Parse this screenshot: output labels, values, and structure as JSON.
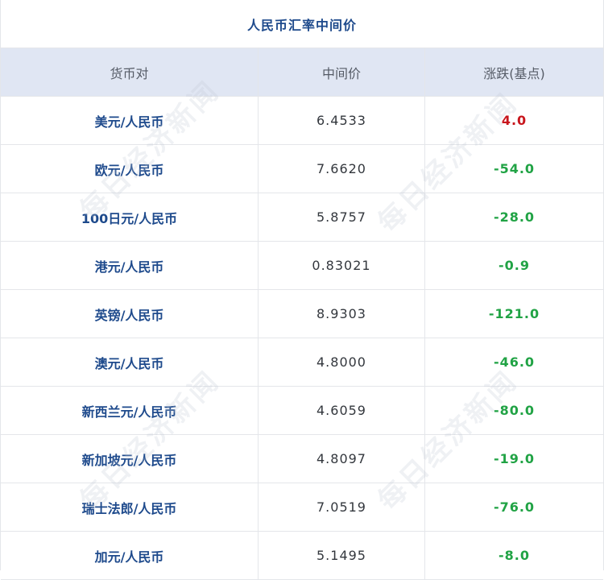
{
  "title": "人民币汇率中间价",
  "headers": [
    "货币对",
    "中间价",
    "涨跌(基点)"
  ],
  "rows": [
    {
      "pair": "美元/人民币",
      "mid": "6.4533",
      "change": "4.0",
      "dir": "up"
    },
    {
      "pair": "欧元/人民币",
      "mid": "7.6620",
      "change": "-54.0",
      "dir": "down"
    },
    {
      "pair": "100日元/人民币",
      "mid": "5.8757",
      "change": "-28.0",
      "dir": "down"
    },
    {
      "pair": "港元/人民币",
      "mid": "0.83021",
      "change": "-0.9",
      "dir": "down"
    },
    {
      "pair": "英镑/人民币",
      "mid": "8.9303",
      "change": "-121.0",
      "dir": "down"
    },
    {
      "pair": "澳元/人民币",
      "mid": "4.8000",
      "change": "-46.0",
      "dir": "down"
    },
    {
      "pair": "新西兰元/人民币",
      "mid": "4.6059",
      "change": "-80.0",
      "dir": "down"
    },
    {
      "pair": "新加坡元/人民币",
      "mid": "4.8097",
      "change": "-19.0",
      "dir": "down"
    },
    {
      "pair": "瑞士法郎/人民币",
      "mid": "7.0519",
      "change": "-76.0",
      "dir": "down"
    },
    {
      "pair": "加元/人民币",
      "mid": "5.1495",
      "change": "-8.0",
      "dir": "down"
    }
  ],
  "watermark": "每日经济新闻",
  "colors": {
    "up": "#c8161d",
    "down": "#21a345",
    "pair": "#1e4a8c",
    "header_bg": "#e0e6f3"
  }
}
